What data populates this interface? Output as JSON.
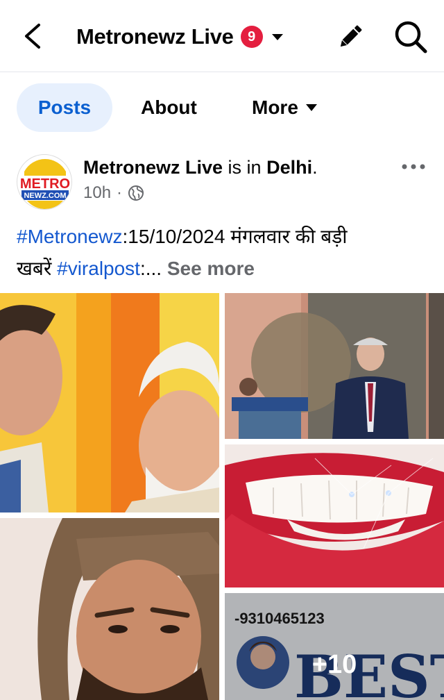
{
  "header": {
    "title": "Metronewz Live",
    "badge_count": "9",
    "icons": [
      "back-arrow-icon",
      "chevron-down-icon",
      "pencil-icon",
      "search-icon"
    ]
  },
  "tabs": [
    {
      "label": "Posts",
      "active": true
    },
    {
      "label": "About",
      "active": false
    },
    {
      "label": "More",
      "active": false
    }
  ],
  "post": {
    "author": "Metronewz Live",
    "is_in": " is in ",
    "location": "Delhi",
    "location_end": ".",
    "time": "10h",
    "dot": "·",
    "privacy_icon": "globe-icon",
    "text": {
      "tag1": "#Metronewz",
      "line1_rest": ":15/10/2024  मंगलवार की बड़ी",
      "line2_start": "खबरें ",
      "tag2": "#viralpost",
      "line2_rest": ":...",
      "see_more": "See more"
    },
    "more_photos": "+10"
  },
  "logo": {
    "top": "METRO",
    "bottom": "NEWZ.COM"
  },
  "photo_overlay": {
    "phone": "-9310465123",
    "sign": "BEST"
  },
  "colors": {
    "accent": "#0a5fd0",
    "tab_active_bg": "#e7f0fd",
    "badge": "#e41e3f",
    "hashtag": "#1458cf",
    "secondary_text": "#65676b"
  }
}
